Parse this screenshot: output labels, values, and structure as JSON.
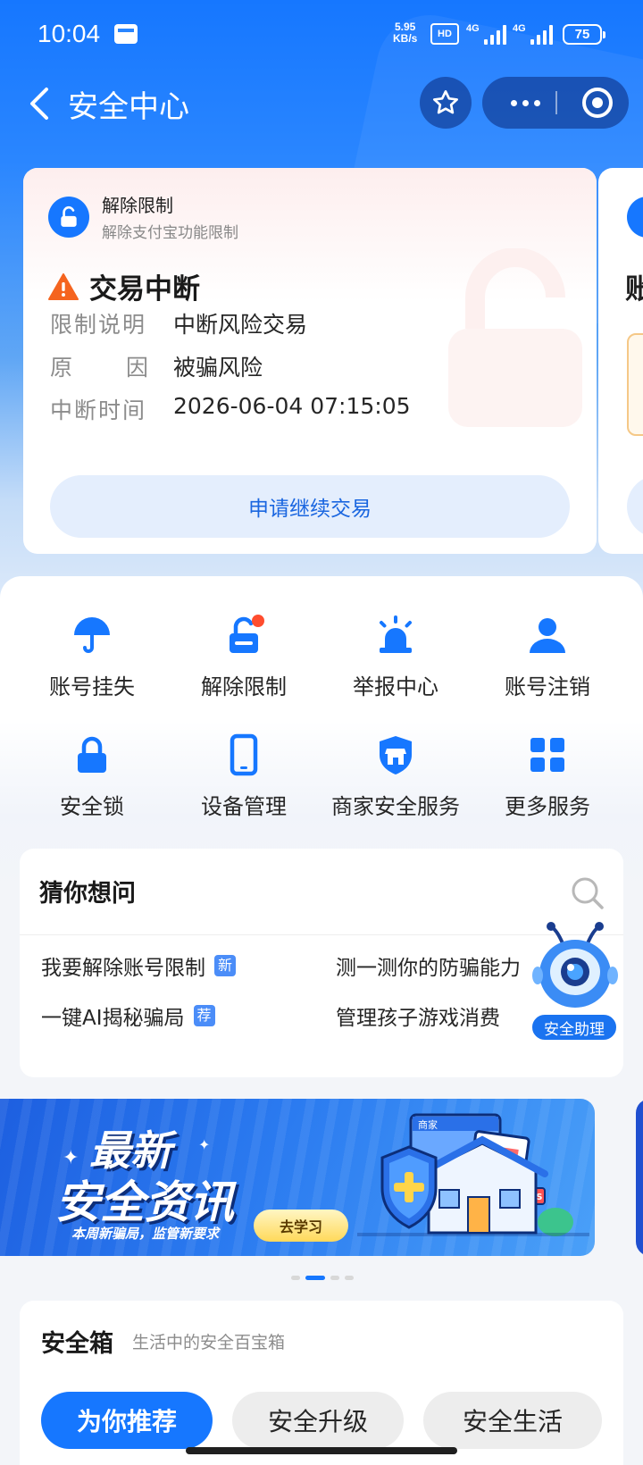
{
  "status_bar": {
    "time": "10:04",
    "net_speed_value": "5.95",
    "net_speed_unit": "KB/s",
    "hd": "HD",
    "signal_1": "4G",
    "signal_2": "4G",
    "battery": "75"
  },
  "nav": {
    "title": "安全中心"
  },
  "restriction_card": {
    "title": "解除限制",
    "subtitle": "解除支付宝功能限制",
    "status": "交易中断",
    "rows": [
      {
        "key": "限制说明",
        "value": "中断风险交易"
      },
      {
        "key_a": "原",
        "key_b": "因",
        "value": "被骗风险"
      },
      {
        "key": "中断时间",
        "value": "2026-06-04 07:15:05"
      }
    ],
    "button": "申请继续交易"
  },
  "peek_card": {
    "text": "账"
  },
  "services": [
    {
      "label": "账号挂失",
      "icon": "umbrella-icon"
    },
    {
      "label": "解除限制",
      "icon": "unlock-icon"
    },
    {
      "label": "举报中心",
      "icon": "alarm-icon"
    },
    {
      "label": "账号注销",
      "icon": "user-icon"
    },
    {
      "label": "安全锁",
      "icon": "lock-icon"
    },
    {
      "label": "设备管理",
      "icon": "phone-icon"
    },
    {
      "label": "商家安全服务",
      "icon": "shop-shield-icon"
    },
    {
      "label": "更多服务",
      "icon": "grid-icon"
    }
  ],
  "guess": {
    "title": "猜你想问",
    "questions": [
      {
        "text": "我要解除账号限制",
        "tag": "新"
      },
      {
        "text": "测一测你的防骗能力",
        "tag": ""
      },
      {
        "text": "一键AI揭秘骗局",
        "tag": "荐"
      },
      {
        "text": "管理孩子游戏消费",
        "tag": ""
      }
    ]
  },
  "assistant": {
    "label": "安全助理"
  },
  "banner": {
    "line1": "最新",
    "line2": "安全资讯",
    "subtitle": "本周新骗局，监管新要求",
    "button": "去学习",
    "sign_shop": "商家",
    "sign_news": "NEWS"
  },
  "carousel": {
    "count": 4,
    "active_index": 1
  },
  "safebox": {
    "title": "安全箱",
    "subtitle": "生活中的安全百宝箱",
    "tabs": [
      {
        "label": "为你推荐",
        "active": true
      },
      {
        "label": "安全升级",
        "active": false
      },
      {
        "label": "安全生活",
        "active": false
      }
    ]
  },
  "colors": {
    "brand_blue": "#1677ff",
    "warning_orange": "#f5641f",
    "badge_red": "#ff4d2e"
  }
}
